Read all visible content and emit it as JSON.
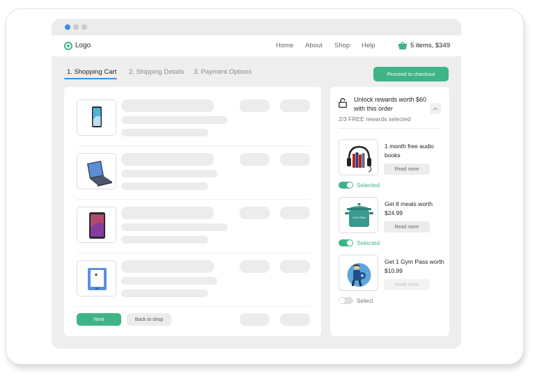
{
  "window": {
    "dots": [
      "#3e8ddf",
      "#c9c9c9",
      "#c9c9c9"
    ]
  },
  "header": {
    "logo_label": "Logo",
    "nav": [
      "Home",
      "About",
      "Shop",
      "Help"
    ],
    "cart_summary": "5 items, $349"
  },
  "steps": [
    {
      "label": "1. Shopping Cart",
      "active": true
    },
    {
      "label": "2. Shipping Details",
      "active": false
    },
    {
      "label": "3. Payment Options",
      "active": false
    }
  ],
  "checkout_label": "Proceed to checkout",
  "cart": {
    "items": [
      {
        "icon": "phone-icon"
      },
      {
        "icon": "laptop-icon"
      },
      {
        "icon": "tablet-icon"
      },
      {
        "icon": "ereader-icon"
      }
    ],
    "next_label": "Next",
    "back_label": "Back to shop"
  },
  "rewards": {
    "title": "Unlock rewards worth $60 with this order",
    "subtitle": "2/3 FREE rewards selected",
    "items": [
      {
        "title": "1 month free audio books",
        "read_more": "Read more",
        "selected": true,
        "toggle_label": "Selected",
        "icon": "audiobook-icon"
      },
      {
        "title": "Get 8 meals worth $24.99",
        "read_more": "Read more",
        "selected": true,
        "toggle_label": "Selected",
        "icon": "meal-pot-icon"
      },
      {
        "title": "Get 1 Gym Pass worth $10.99",
        "read_more": "Read more",
        "selected": false,
        "toggle_label": "Select",
        "icon": "gym-icon"
      }
    ],
    "pot_label": "Let's Dish"
  },
  "colors": {
    "accent": "#3fb487",
    "tab_active": "#3e8ddf"
  }
}
